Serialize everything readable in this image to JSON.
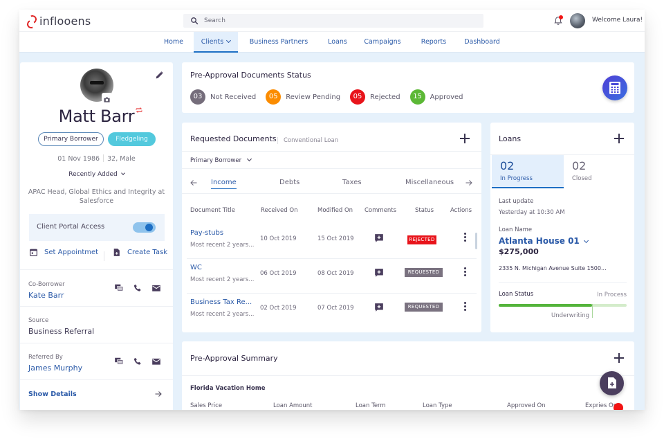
{
  "header": {
    "logo_text": "inflooens",
    "search_placeholder": "Search",
    "welcome": "Welcome Laura!",
    "brand_color": "#e02424"
  },
  "nav": {
    "items": [
      {
        "label": "Home"
      },
      {
        "label": "Clients",
        "active": true,
        "has_dropdown": true
      },
      {
        "label": "Business Partners"
      },
      {
        "label": "Loans"
      },
      {
        "label": "Campaigns"
      },
      {
        "label": "Reports"
      },
      {
        "label": "Dashboard"
      }
    ]
  },
  "profile": {
    "name": "Matt Barr",
    "tags": [
      "Primary Borrower",
      "Fledgeling"
    ],
    "dob": "01 Nov 1986",
    "age_gender": "32, Male",
    "recently_added": "Recently Added",
    "role": "APAC Head, Global Ethics and Integrity at Salesforce",
    "portal_access_label": "Client Portal Access",
    "portal_access_enabled": true,
    "set_appointment": "Set Appointmet",
    "create_task": "Create Task",
    "co_borrower_label": "Co-Borrower",
    "co_borrower": "Kate Barr",
    "source_label": "Source",
    "source": "Business Referral",
    "referred_by_label": "Referred By",
    "referred_by": "James Murphy",
    "show_details": "Show Details"
  },
  "doc_status": {
    "title": "Pre-Approval Documents Status",
    "items": [
      {
        "count": "03",
        "label": "Not Received",
        "color": "#756d7b"
      },
      {
        "count": "05",
        "label": "Review Pending",
        "color": "#fb8c00"
      },
      {
        "count": "05",
        "label": "Rejected",
        "color": "#e8141b"
      },
      {
        "count": "15",
        "label": "Approved",
        "color": "#5cb836"
      }
    ]
  },
  "requested_docs": {
    "title": "Requested Documents",
    "subtitle": "Conventional Loan",
    "borrower_select": "Primary Borrower",
    "tabs": [
      "Income",
      "Debts",
      "Taxes",
      "Miscellaneous"
    ],
    "active_tab": "Income",
    "columns": [
      "Document Title",
      "Received On",
      "Modified On",
      "Comments",
      "Status",
      "Actions"
    ],
    "rows": [
      {
        "title": "Pay-stubs",
        "desc": "Most recent 2 years...",
        "received": "10 Oct 2019",
        "modified": "15 Oct 2019",
        "status": "REJECTED",
        "status_color": "#e8141b"
      },
      {
        "title": "WC",
        "desc": "Most recent 2 years...",
        "received": "06 Oct 2019",
        "modified": "08 Oct 2019",
        "status": "REQUESTED",
        "status_color": "#7a7280"
      },
      {
        "title": "Business Tax Re...",
        "desc": "Most recent 2 years...",
        "received": "02 Oct 2019",
        "modified": "07 Oct 2019",
        "status": "REQUESTED",
        "status_color": "#7a7280"
      }
    ]
  },
  "loans": {
    "title": "Loans",
    "tabs": [
      {
        "count": "02",
        "label": "In Progress",
        "active": true
      },
      {
        "count": "02",
        "label": "Closed"
      }
    ],
    "last_update_label": "Last update",
    "last_update": "Yesterday at 10:30 AM",
    "loan_name_label": "Loan Name",
    "loan_name": "Atlanta House 01",
    "amount": "$275,000",
    "address": "2335 N. Michigan Avenue Suite 1500...",
    "status_label": "Loan Status",
    "status_value": "In Process",
    "stage": "Underwriting",
    "progress_fraction": 0.73
  },
  "summary": {
    "title": "Pre-Approval Summary",
    "property": "Florida Vacation Home",
    "columns": [
      "Sales Price",
      "Loan Amount",
      "Loan Term",
      "Loan Type",
      "Approved On",
      "Expries On"
    ]
  }
}
